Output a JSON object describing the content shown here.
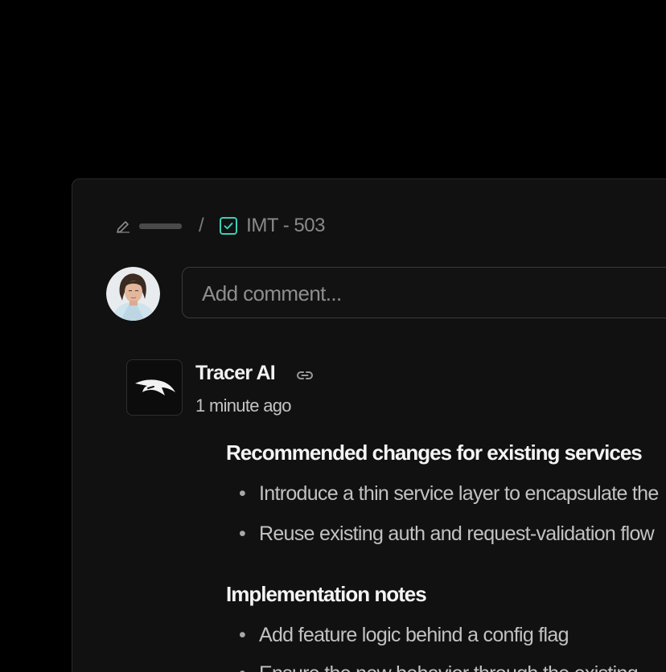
{
  "breadcrumb": {
    "issue_id": "IMT - 503",
    "separator": "/"
  },
  "comment": {
    "placeholder": "Add comment..."
  },
  "author": {
    "name": "Tracer AI",
    "time": "1 minute ago"
  },
  "sections": [
    {
      "heading": "Recommended changes for existing services",
      "bullets": [
        "Introduce a thin service layer to encapsulate the",
        "Reuse existing auth and request-validation flow"
      ]
    },
    {
      "heading": "Implementation notes",
      "bullets": [
        "Add feature logic behind a config flag",
        "Ensure the new behavior through the existing"
      ]
    }
  ],
  "colors": {
    "background": "#000000",
    "panel": "#111111",
    "accent_teal": "#3ccfb6"
  },
  "icons": [
    "pencil-icon",
    "task-check-icon",
    "avatar",
    "tracer-logo-icon",
    "link-icon"
  ]
}
